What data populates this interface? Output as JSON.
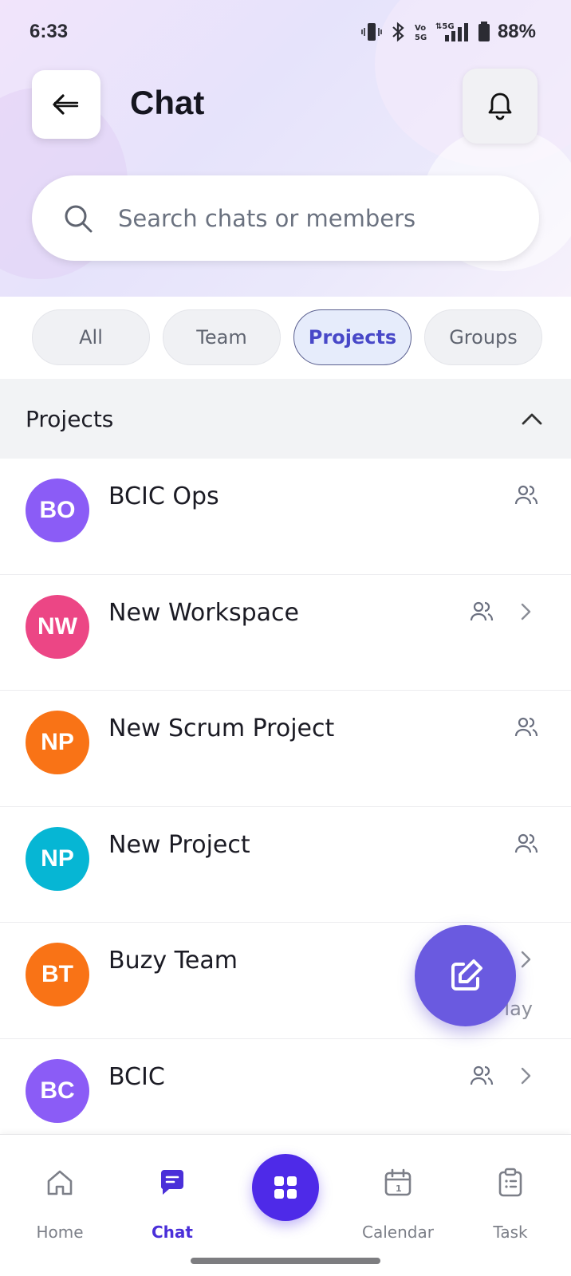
{
  "status_bar": {
    "time": "6:33",
    "battery": "88%"
  },
  "header": {
    "title": "Chat"
  },
  "search": {
    "placeholder": "Search chats or members"
  },
  "filters": [
    {
      "label": "All",
      "active": false
    },
    {
      "label": "Team",
      "active": false
    },
    {
      "label": "Projects",
      "active": true
    },
    {
      "label": "Groups",
      "active": false
    }
  ],
  "section": {
    "title": "Projects"
  },
  "chats": [
    {
      "initials": "BO",
      "name": "BCIC Ops",
      "color": "#8b5cf6",
      "has_chevron": false
    },
    {
      "initials": "NW",
      "name": "New Workspace",
      "color": "#ec4685",
      "has_chevron": true
    },
    {
      "initials": "NP",
      "name": "New Scrum Project",
      "color": "#f97316",
      "has_chevron": false
    },
    {
      "initials": "NP",
      "name": "New Project",
      "color": "#06b6d4",
      "has_chevron": false
    },
    {
      "initials": "BT",
      "name": "Buzy Team",
      "color": "#f97316",
      "has_chevron": true,
      "time": "lay"
    },
    {
      "initials": "BC",
      "name": "BCIC",
      "color": "#8b5cf6",
      "has_chevron": true
    }
  ],
  "nav": {
    "home": "Home",
    "chat": "Chat",
    "calendar": "Calendar",
    "task": "Task"
  },
  "colors": {
    "accent": "#4e2ae8",
    "fab": "#6a5ae0"
  }
}
